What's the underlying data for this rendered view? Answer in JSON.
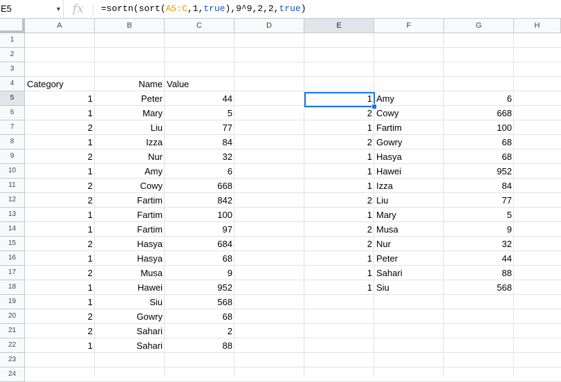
{
  "name_box": "E5",
  "formula": {
    "prefix": "=sortn(sort(",
    "ref": "A5:C",
    "mid1": ",1,",
    "kw1": "true",
    "mid2": "),9^9,2,2,",
    "kw2": "true",
    "suffix": ")"
  },
  "columns": [
    "A",
    "B",
    "C",
    "D",
    "E",
    "F",
    "G",
    "H"
  ],
  "rows": [
    "1",
    "2",
    "3",
    "4",
    "5",
    "6",
    "7",
    "8",
    "9",
    "10",
    "11",
    "12",
    "13",
    "14",
    "15",
    "16",
    "17",
    "18",
    "19",
    "20",
    "21",
    "22",
    "23",
    "24"
  ],
  "headers": {
    "a": "Category",
    "b": "Name",
    "c": "Value"
  },
  "source": [
    {
      "cat": "1",
      "name": "Peter",
      "value": "44"
    },
    {
      "cat": "1",
      "name": "Mary",
      "value": "5"
    },
    {
      "cat": "2",
      "name": "Liu",
      "value": "77"
    },
    {
      "cat": "1",
      "name": "Izza",
      "value": "84"
    },
    {
      "cat": "2",
      "name": "Nur",
      "value": "32"
    },
    {
      "cat": "1",
      "name": "Amy",
      "value": "6"
    },
    {
      "cat": "2",
      "name": "Cowy",
      "value": "668"
    },
    {
      "cat": "2",
      "name": "Fartim",
      "value": "842"
    },
    {
      "cat": "1",
      "name": "Fartim",
      "value": "100"
    },
    {
      "cat": "1",
      "name": "Fartim",
      "value": "97"
    },
    {
      "cat": "2",
      "name": "Hasya",
      "value": "684"
    },
    {
      "cat": "1",
      "name": "Hasya",
      "value": "68"
    },
    {
      "cat": "2",
      "name": "Musa",
      "value": "9"
    },
    {
      "cat": "1",
      "name": "Hawei",
      "value": "952"
    },
    {
      "cat": "1",
      "name": "Siu",
      "value": "568"
    },
    {
      "cat": "2",
      "name": "Gowry",
      "value": "68"
    },
    {
      "cat": "2",
      "name": "Sahari",
      "value": "2"
    },
    {
      "cat": "1",
      "name": "Sahari",
      "value": "88"
    }
  ],
  "result": [
    {
      "cat": "1",
      "name": "Amy",
      "value": "6"
    },
    {
      "cat": "2",
      "name": "Cowy",
      "value": "668"
    },
    {
      "cat": "1",
      "name": "Fartim",
      "value": "100"
    },
    {
      "cat": "2",
      "name": "Gowry",
      "value": "68"
    },
    {
      "cat": "1",
      "name": "Hasya",
      "value": "68"
    },
    {
      "cat": "1",
      "name": "Hawei",
      "value": "952"
    },
    {
      "cat": "1",
      "name": "Izza",
      "value": "84"
    },
    {
      "cat": "2",
      "name": "Liu",
      "value": "77"
    },
    {
      "cat": "1",
      "name": "Mary",
      "value": "5"
    },
    {
      "cat": "2",
      "name": "Musa",
      "value": "9"
    },
    {
      "cat": "2",
      "name": "Nur",
      "value": "32"
    },
    {
      "cat": "1",
      "name": "Peter",
      "value": "44"
    },
    {
      "cat": "1",
      "name": "Sahari",
      "value": "88"
    },
    {
      "cat": "1",
      "name": "Siu",
      "value": "568"
    }
  ]
}
